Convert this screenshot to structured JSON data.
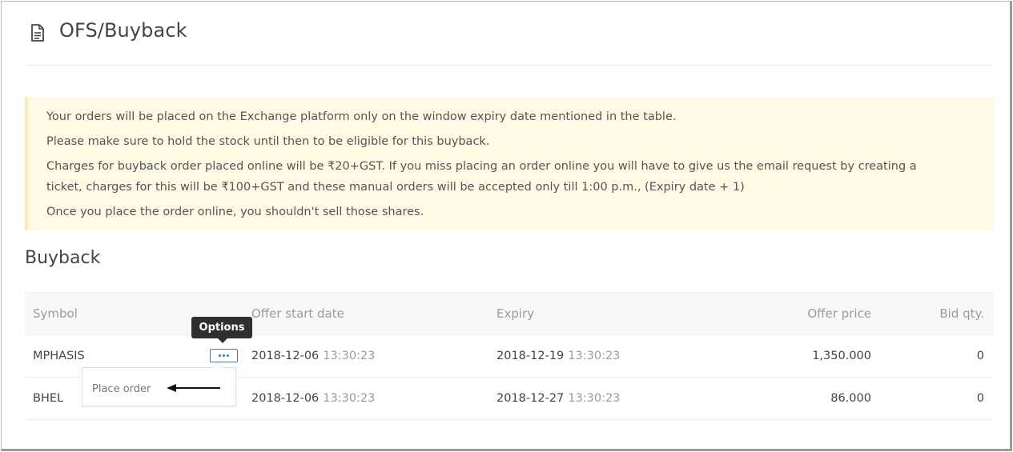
{
  "page": {
    "title": "OFS/Buyback",
    "title_icon": "document-icon"
  },
  "notice": {
    "line1": "Your orders will be placed on the Exchange platform only on the window expiry date mentioned in the table.",
    "line2": "Please make sure to hold the stock until then to be eligible for this buyback.",
    "line3": "Charges for buyback order placed online will be ₹20+GST. If you miss placing an order online you will have to give us the email request by creating a ticket, charges for this will be ₹100+GST and these manual orders will be accepted only till 1:00 p.m., (Expiry date + 1)",
    "line4": "Once you place the order online, you shouldn't sell those shares."
  },
  "section": {
    "title": "Buyback"
  },
  "table": {
    "headers": {
      "symbol": "Symbol",
      "offer_start": "Offer start date",
      "expiry": "Expiry",
      "offer_price": "Offer price",
      "bid_qty": "Bid qty."
    },
    "rows": [
      {
        "symbol": "MPHASIS",
        "start_date": "2018-12-06",
        "start_time": "13:30:23",
        "expiry_date": "2018-12-19",
        "expiry_time": "13:30:23",
        "offer_price": "1,350.000",
        "bid_qty": "0"
      },
      {
        "symbol": "BHEL",
        "start_date": "2018-12-06",
        "start_time": "13:30:23",
        "expiry_date": "2018-12-27",
        "expiry_time": "13:30:23",
        "offer_price": "86.000",
        "bid_qty": "0"
      }
    ]
  },
  "options_menu": {
    "tooltip": "Options",
    "items": [
      "Place order"
    ]
  },
  "colors": {
    "accent": "#3b7fb5",
    "notice_bg": "#fff9e5",
    "tooltip_bg": "#2f2f2f"
  }
}
